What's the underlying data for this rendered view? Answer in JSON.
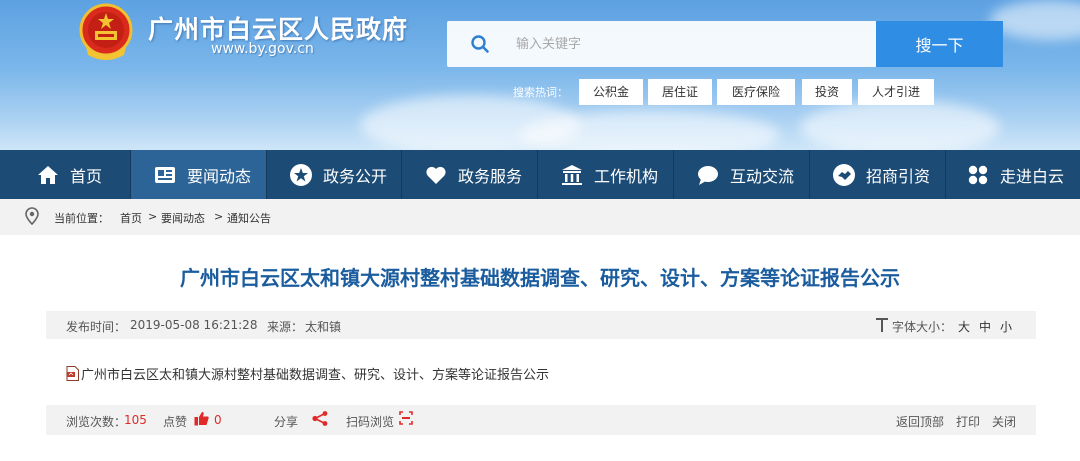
{
  "header": {
    "site_title": "广州市白云区人民政府",
    "site_url": "www.by.gov.cn"
  },
  "search": {
    "placeholder": "输入关键字",
    "button_label": "搜一下",
    "hot_label": "搜索热词：",
    "hot_tags": [
      "公积金",
      "居住证",
      "医疗保险",
      "投资",
      "人才引进"
    ]
  },
  "nav": {
    "items": [
      {
        "label": "首页",
        "icon": "home-icon"
      },
      {
        "label": "要闻动态",
        "icon": "news-icon",
        "active": true
      },
      {
        "label": "政务公开",
        "icon": "star-icon"
      },
      {
        "label": "政务服务",
        "icon": "heart-icon"
      },
      {
        "label": "工作机构",
        "icon": "building-icon"
      },
      {
        "label": "互动交流",
        "icon": "chat-icon"
      },
      {
        "label": "招商引资",
        "icon": "handshake-icon"
      },
      {
        "label": "走进白云",
        "icon": "grid-icon"
      }
    ]
  },
  "breadcrumb": {
    "prefix": "当前位置：",
    "items": [
      "首页",
      "要闻动态",
      "通知公告"
    ],
    "separator": ">"
  },
  "article": {
    "title": "广州市白云区太和镇大源村整村基础数据调查、研究、设计、方案等论证报告公示",
    "publish_label": "发布时间：",
    "publish_time": "2019-05-08 16:21:28",
    "source_label": "来源：",
    "source": "太和镇",
    "font_size_label": "字体大小：",
    "font_size_options": [
      "大",
      "中",
      "小"
    ],
    "attachment": "广州市白云区太和镇大源村整村基础数据调查、研究、设计、方案等论证报告公示"
  },
  "footer": {
    "views_label": "浏览次数：",
    "views": "105",
    "likes_label": "点赞",
    "likes": "0",
    "share_label": "分享",
    "scan_label": "扫码浏览",
    "back_top": "返回顶部",
    "print": "打印",
    "close": "关闭"
  },
  "colors": {
    "nav_bg": "#1c4b75",
    "nav_active": "#2c6497",
    "title": "#1a5c9e",
    "search_button": "#2f8de4",
    "accent_red": "#e02a2a"
  }
}
